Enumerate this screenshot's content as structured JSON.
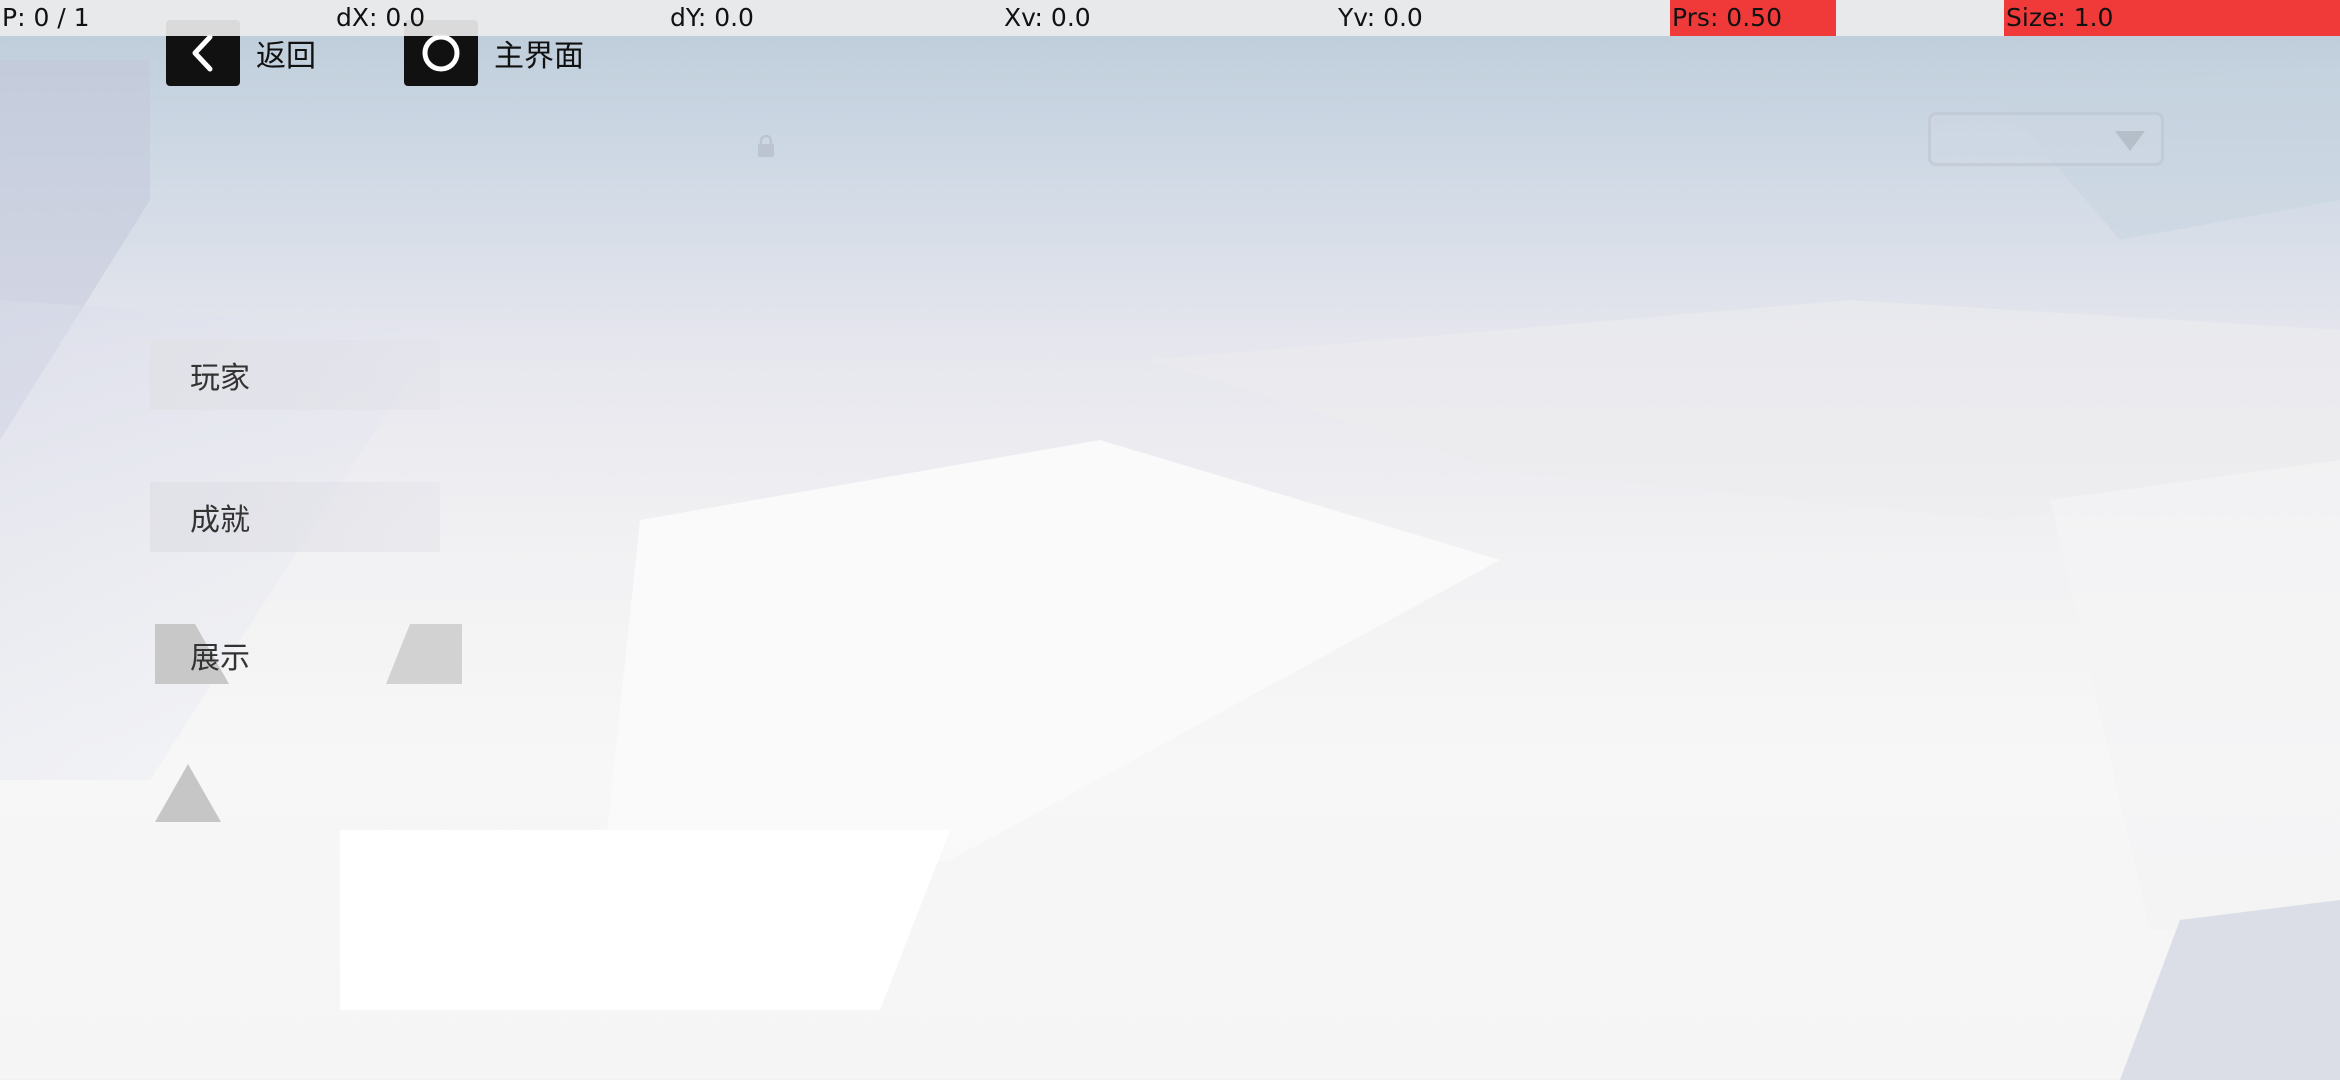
{
  "pointer_debug": {
    "p": "P: 0 / 1",
    "dx": "dX: 0.0",
    "dy": "dY: 0.0",
    "xv": "Xv: 0.0",
    "yv": "Yv: 0.0",
    "prs": "Prs: 0.50",
    "size": "Size: 1.0",
    "highlight_color": "#f03a3a"
  },
  "nav": {
    "back_label": "返回",
    "back_icon": "chevron-left-icon",
    "home_label": "主界面",
    "home_icon": "circle-home-icon"
  },
  "top_right": {
    "dropdown_icon": "triangle-down-icon"
  },
  "menu": {
    "items": [
      {
        "label": "玩家"
      },
      {
        "label": "成就"
      },
      {
        "label": "展示"
      }
    ]
  },
  "decorations": {
    "lock_icon": "lock-icon",
    "triangle_icon": "triangle-up-icon"
  }
}
